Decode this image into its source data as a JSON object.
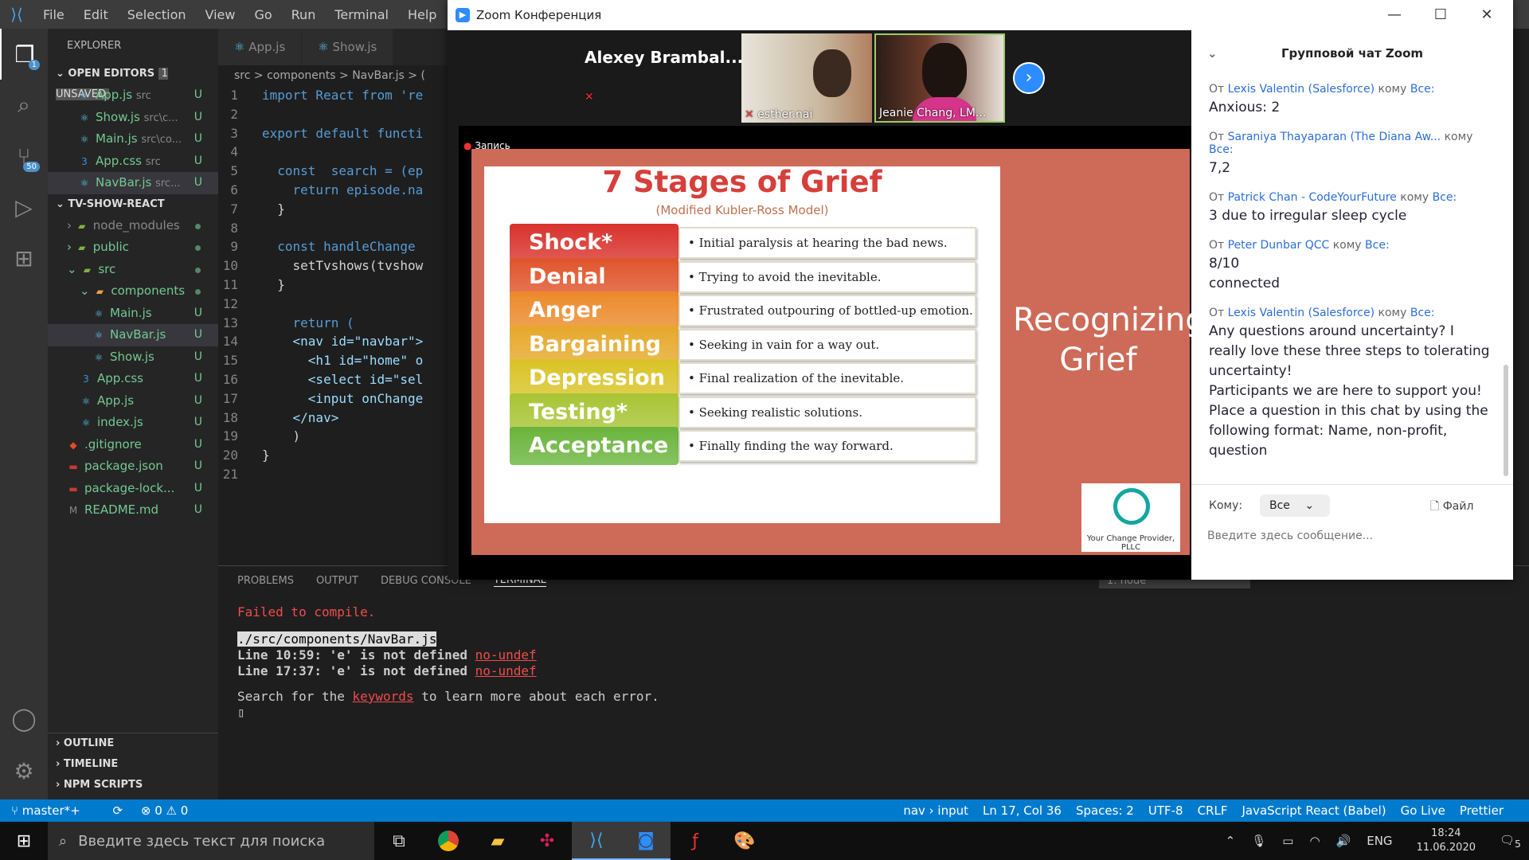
{
  "vscode": {
    "menu": [
      "File",
      "Edit",
      "Selection",
      "View",
      "Go",
      "Run",
      "Terminal",
      "Help"
    ],
    "explorer_title": "EXPLORER",
    "open_editors": {
      "label": "OPEN EDITORS",
      "unsaved": "1 UNSAVED",
      "items": [
        {
          "name": "App.js",
          "path": "src",
          "status": "U",
          "icon": "react-icon"
        },
        {
          "name": "Show.js",
          "path": "src\\c...",
          "status": "U",
          "icon": "react-icon"
        },
        {
          "name": "Main.js",
          "path": "src\\co...",
          "status": "U",
          "icon": "react-icon"
        },
        {
          "name": "App.css",
          "path": "src",
          "status": "U",
          "icon": "css-icon"
        },
        {
          "name": "NavBar.js",
          "path": "src...",
          "status": "U",
          "icon": "react-icon"
        }
      ]
    },
    "project": {
      "label": "TV-SHOW-REACT",
      "items": [
        {
          "name": "node_modules",
          "indent": 1
        },
        {
          "name": "public",
          "indent": 1
        },
        {
          "name": "src",
          "indent": 1
        },
        {
          "name": "components",
          "indent": 2
        },
        {
          "name": "Main.js",
          "indent": 3,
          "status": "U"
        },
        {
          "name": "NavBar.js",
          "indent": 3,
          "status": "U"
        },
        {
          "name": "Show.js",
          "indent": 3,
          "status": "U"
        },
        {
          "name": "App.css",
          "indent": 2,
          "status": "U"
        },
        {
          "name": "App.js",
          "indent": 2,
          "status": "U"
        },
        {
          "name": "index.js",
          "indent": 2,
          "status": "U"
        },
        {
          "name": ".gitignore",
          "indent": 1,
          "status": "U"
        },
        {
          "name": "package.json",
          "indent": 1,
          "status": "U"
        },
        {
          "name": "package-lock...",
          "indent": 1,
          "status": "U"
        },
        {
          "name": "README.md",
          "indent": 1,
          "status": "U"
        }
      ]
    },
    "outline": "OUTLINE",
    "timeline": "TIMELINE",
    "npm": "NPM SCRIPTS",
    "tabs": [
      "App.js",
      "Show.js"
    ],
    "breadcrumb": "src > components > NavBar.js > (",
    "code_lines": [
      "import React from 're",
      "",
      "export default functi",
      "",
      "  const  search = (ep",
      "    return episode.na",
      "  }",
      "",
      "  const handleChange ",
      "    setTvshows(tvshow",
      "  }",
      "",
      "    return (",
      "    <nav id=\"navbar\">",
      "      <h1 id=\"home\" o",
      "      <select id=\"sel",
      "      <input onChange",
      "    </nav>",
      "    )",
      "}",
      ""
    ],
    "panel_tabs": [
      "PROBLEMS",
      "OUTPUT",
      "DEBUG CONSOLE",
      "TERMINAL"
    ],
    "terminal_select": "1: node",
    "terminal": {
      "fail": "Failed to compile.",
      "file": "./src/components/NavBar.js",
      "e1": "  Line 10:59:  'e' is not defined  ",
      "e2": "  Line 17:37:  'e' is not defined  ",
      "rule": "no-undef",
      "help_a": "Search for the ",
      "help_kw": "keywords",
      "help_b": " to learn more about each error."
    },
    "status_left": [
      "master*+",
      "⊗ 0 ⚠ 0"
    ],
    "status_right": [
      "nav › input",
      "Ln 17, Col 36",
      "Spaces: 2",
      "UTF-8",
      "CRLF",
      "JavaScript React (Babel)",
      "Go Live",
      "Prettier"
    ]
  },
  "zoom": {
    "title": "Zoom Конференция",
    "speaker_name": "Alexey  Brambal...",
    "tiles": [
      {
        "name": "esther.nai"
      },
      {
        "name": "Jeanie Chang, LM..."
      }
    ],
    "recording": "Запись",
    "slide": {
      "title": "7 Stages of Grief",
      "subtitle": "(Modified Kubler-Ross Model)",
      "side_title": "Recognizing Grief",
      "logo_text": "Your Change Provider, PLLC",
      "stages": [
        {
          "name": "Shock*",
          "desc": "• Initial paralysis at hearing the bad news.",
          "color": "#d9322c"
        },
        {
          "name": "Denial",
          "desc": "• Trying to avoid the inevitable.",
          "color": "#e0542b"
        },
        {
          "name": "Anger",
          "desc": "• Frustrated outpouring of  bottled-up emotion.",
          "color": "#ec8a2a"
        },
        {
          "name": "Bargaining",
          "desc": "• Seeking in vain for a way out.",
          "color": "#e6a82a"
        },
        {
          "name": "Depression",
          "desc": "• Final realization of  the inevitable.",
          "color": "#d9c325"
        },
        {
          "name": "Testing*",
          "desc": "• Seeking realistic solutions.",
          "color": "#a8c434"
        },
        {
          "name": "Acceptance",
          "desc": "• Finally finding the way forward.",
          "color": "#6ab43c"
        }
      ]
    },
    "chat": {
      "title": "Групповой чат Zoom",
      "messages": [
        {
          "prefix": "От ",
          "from": "Lexis Valentin (Salesforce)",
          "mid": " кому ",
          "to": "Все:",
          "text": "Anxious: 2"
        },
        {
          "prefix": "От ",
          "from": "Saraniya Thayaparan (The Diana Aw...",
          "mid": " кому ",
          "to": "Все:",
          "text": "7,2"
        },
        {
          "prefix": "От ",
          "from": "Patrick Chan - CodeYourFuture",
          "mid": " кому ",
          "to": "Все:",
          "text": "3 due to irregular sleep cycle"
        },
        {
          "prefix": "От ",
          "from": "Peter Dunbar QCC",
          "mid": " кому ",
          "to": "Все:",
          "text": "8/10\nconnected"
        },
        {
          "prefix": "От ",
          "from": "Lexis Valentin (Salesforce)",
          "mid": " кому ",
          "to": "Все:",
          "text": "Any questions around uncertainty? I really love these three steps to tolerating uncertainty!\nParticipants we are here to support you! Place a question in this chat by using the following format: Name, non-profit, question"
        }
      ],
      "to_label": "Кому:",
      "to_value": "Все",
      "file_label": "Файл",
      "placeholder": "Введите здесь сообщение..."
    }
  },
  "taskbar": {
    "search_placeholder": "Введите здесь текст для поиска",
    "lang": "ENG",
    "time": "18:24",
    "date": "11.06.2020",
    "notif": "5"
  }
}
